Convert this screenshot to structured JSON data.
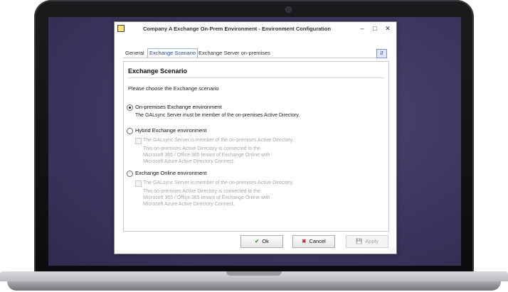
{
  "window": {
    "title": "Company A Exchange On-Prem Environment - Environment Configuration",
    "controls": {
      "minimize": "–",
      "maximize": "□",
      "close": "✕"
    }
  },
  "tabs": [
    {
      "label": "General"
    },
    {
      "label": "Exchange Scenario"
    },
    {
      "label": "Exchange Server on-premises"
    }
  ],
  "help_button": "⇵",
  "panel": {
    "heading": "Exchange Scenario",
    "prompt": "Please choose the Exchange scenario",
    "options": [
      {
        "label": "On-premises Exchange environment",
        "selected": true,
        "note": "The GALsync Server must be member of the on-premises Active Directory."
      },
      {
        "label": "Hybrid Exchange environment",
        "selected": false,
        "check_label": "The GALsync Server is member of the on-premises Active Directory.",
        "desc_lines": [
          "This on-premises Active Directory is connected to the",
          "Microsoft 365 / Office 365 tenant of Exchange Online with",
          "Microsoft Azure Active Directory Connect."
        ]
      },
      {
        "label": "Exchange Online environment",
        "selected": false,
        "check_label": "The GALsync Server is member of the on-premises Active Directory.",
        "desc_lines": [
          "This on-premises Active Directory is connected to the",
          "Microsoft 365 / Office 365 tenant of Exchange Online with",
          "Microsoft Azure Active Directory Connect."
        ]
      }
    ]
  },
  "buttons": {
    "ok": {
      "label": "Ok",
      "icon": "✔"
    },
    "cancel": {
      "label": "Cancel",
      "icon": "✖"
    },
    "apply": {
      "label": "Apply",
      "icon": "💾"
    }
  },
  "colors": {
    "accent": "#1b4fa8",
    "ok_icon": "#2e9a2e",
    "cancel_icon": "#c62828"
  }
}
